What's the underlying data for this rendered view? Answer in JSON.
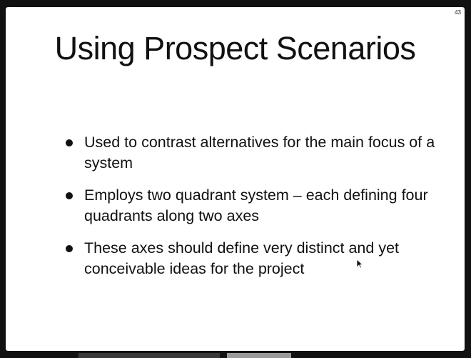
{
  "slide": {
    "number": "43",
    "title": "Using Prospect Scenarios",
    "bullets": [
      "Used to contrast alternatives for the main focus of a system",
      "Employs two quadrant system – each defining four quadrants along two axes",
      "These axes should define very distinct and yet conceivable ideas for the project"
    ]
  },
  "icons": {
    "bullet": "bullet-dot-icon",
    "cursor": "mouse-pointer-icon"
  },
  "colors": {
    "background": "#111111",
    "slide": "#ffffff",
    "text": "#111111"
  }
}
